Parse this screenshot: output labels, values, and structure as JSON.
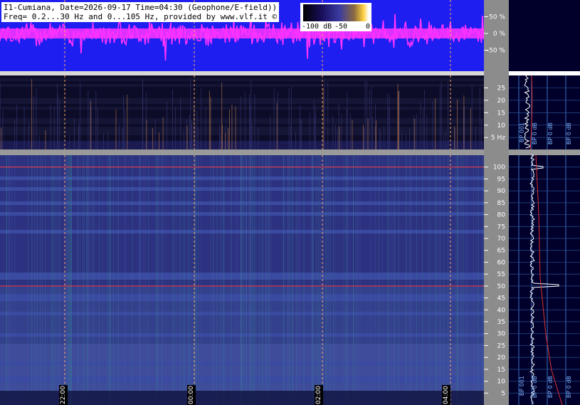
{
  "header": {
    "title_line1": "I1-Cumiana, Date=2026-09-17 Time=04:30 (Geophone/E-field))",
    "title_line2": "Freq= 0.2...30 Hz and 0...105 Hz, provided by www.vlf.it ©"
  },
  "colorbar": {
    "ticks": [
      "-100 dB",
      "-50",
      "0"
    ]
  },
  "colors": {
    "wave_bg": "#1e1ef0",
    "wave_trace": "#ff33ff",
    "marker_line": "#ff4040",
    "grid_dashed": "#ffaa66",
    "spectrum_high_bg": "#2b2e7c",
    "spectrum_low_bg": "#0a0a22"
  },
  "chart_data": [
    {
      "type": "line",
      "panel": "waveform",
      "y_ticks": [
        "50 %",
        "0 %",
        "-50 %"
      ],
      "y_tick_values": [
        50,
        0,
        -50
      ],
      "ylim": [
        -100,
        100
      ]
    },
    {
      "type": "heatmap",
      "panel": "spectrogram-low",
      "y_ticks": [
        "25",
        "20",
        "15",
        "10",
        "5 Hz"
      ],
      "y_tick_values": [
        25,
        20,
        15,
        10,
        5
      ],
      "ylim": [
        0.2,
        30
      ],
      "side_profile_labels": [
        "BP 001",
        "BP 0 dB",
        "BP 0 dB",
        "BP 0 dB"
      ]
    },
    {
      "type": "heatmap",
      "panel": "spectrogram-high",
      "y_ticks": [
        "100",
        "95",
        "90",
        "85",
        "80",
        "75",
        "70",
        "65",
        "60",
        "55",
        "50",
        "45",
        "40",
        "35",
        "30",
        "25",
        "20",
        "15",
        "10",
        "5"
      ],
      "y_tick_values": [
        100,
        95,
        90,
        85,
        80,
        75,
        70,
        65,
        60,
        55,
        50,
        45,
        40,
        35,
        30,
        25,
        20,
        15,
        10,
        5
      ],
      "ylim": [
        0,
        105
      ],
      "marker_lines_hz": [
        100,
        50
      ],
      "side_profile_labels": [
        "BP 001",
        "BP 0 dB",
        "BP 0 dB",
        "BP 0 dB"
      ]
    }
  ],
  "time_axis": {
    "labels": [
      "22:00",
      "00:00",
      "02:00",
      "04:00"
    ]
  }
}
